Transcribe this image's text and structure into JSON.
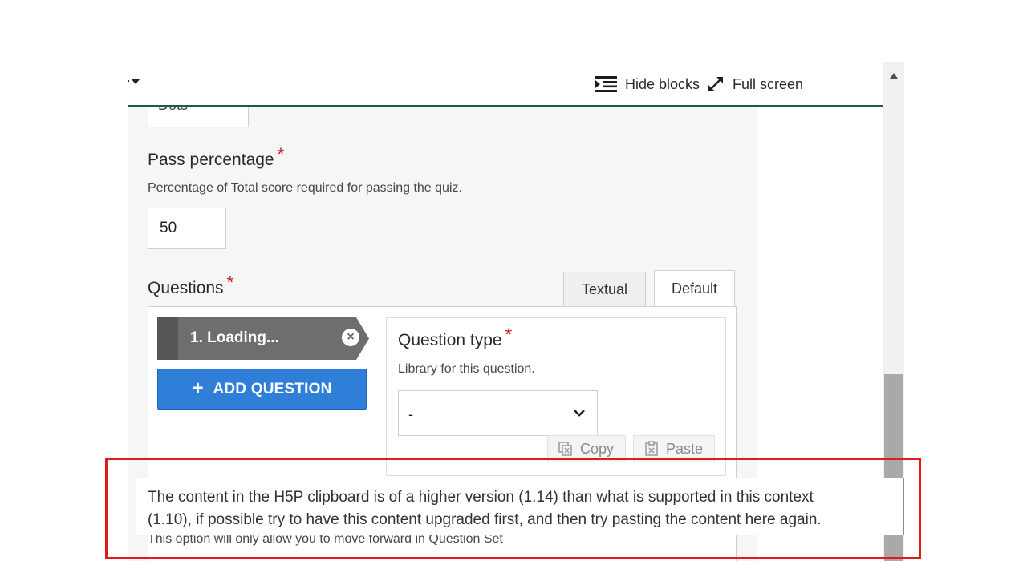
{
  "toolbar": {
    "hide_blocks_label": "Hide blocks",
    "full_screen_label": "Full screen"
  },
  "form": {
    "prev_field_value": "Dots",
    "pass_percentage": {
      "label": "Pass percentage",
      "required_mark": "*",
      "description": "Percentage of Total score required for passing the quiz.",
      "value": "50"
    },
    "questions": {
      "label": "Questions",
      "required_mark": "*",
      "tabs": [
        {
          "label": "Textual",
          "active": false
        },
        {
          "label": "Default",
          "active": true
        }
      ],
      "items": [
        {
          "label": "1. Loading...",
          "remove_symbol": "×"
        }
      ],
      "add_question_label": "ADD QUESTION",
      "add_question_symbol": "+",
      "question_type": {
        "label": "Question type",
        "required_mark": "*",
        "description": "Library for this question.",
        "selected_value": "-",
        "copy_label": "Copy",
        "paste_label": "Paste"
      }
    },
    "bottom_description": "This option will only allow you to move forward in Question Set"
  },
  "tooltip": {
    "line1": "The content in the H5P clipboard is of a higher version (1.14) than what is supported in this context",
    "line2": "(1.10), if possible try to have this content upgraded first, and then try pasting the content here again."
  },
  "colors": {
    "toolbar_underline": "#1f5b44",
    "required": "#c3141b",
    "add_question_bg": "#2f7fd8",
    "question_item_bg": "#6e6e6e",
    "highlight": "#e11a1a"
  },
  "icons": {
    "hide_blocks": "hide-blocks-icon",
    "full_screen": "expand-arrows-icon",
    "remove": "close-circle-icon",
    "select": "chevron-down-icon",
    "copy": "copy-icon",
    "paste": "paste-icon"
  }
}
